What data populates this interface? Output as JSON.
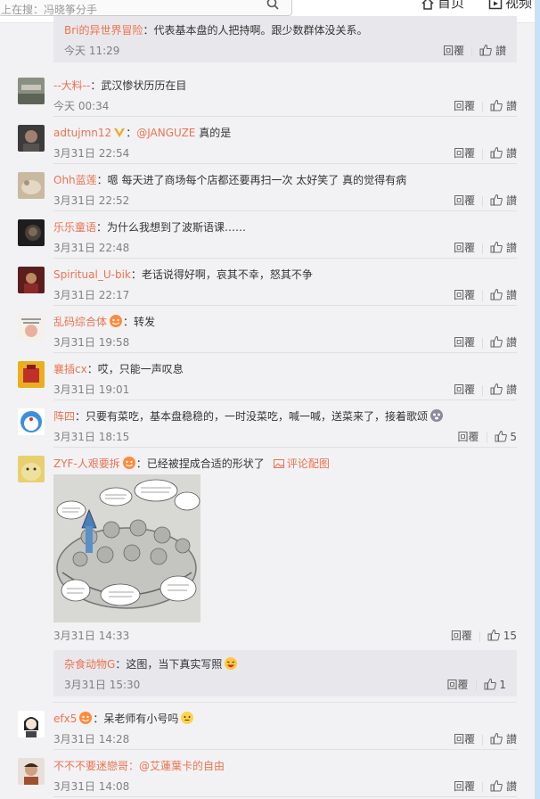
{
  "header": {
    "search_placeholder": "上在搜：冯晓筝分手",
    "home_label": "首页",
    "video_label": "视频"
  },
  "actions": {
    "reply_label": "回覆",
    "like_label": "讃"
  },
  "top_reply": {
    "user": "Bri的异世界冒险",
    "text": "：代表基本盘的人把持啊。跟少数群体没关系。",
    "time": "今天 11:29"
  },
  "comments": [
    {
      "user": "--大料--",
      "text": "：武汉惨状历历在目",
      "time": "今天 00:34"
    },
    {
      "user": "adtujmn12",
      "mention": "@JANGUZE",
      "text": " 真的是",
      "time": "3月31日 22:54"
    },
    {
      "user": "Ohh蓝莲",
      "text": "：嗯 每天进了商场每个店都还要再扫一次 太好笑了 真的觉得有病",
      "time": "3月31日 22:52"
    },
    {
      "user": "乐乐童语",
      "text": "：为什么我想到了波斯语课……",
      "time": "3月31日 22:48"
    },
    {
      "user": "Spiritual_U-bik",
      "text": "：老话说得好啊，哀其不幸，怒其不争",
      "time": "3月31日 22:17"
    },
    {
      "user": "乱码综合体",
      "text": "：转发",
      "time": "3月31日 19:58"
    },
    {
      "user": "襄插cx",
      "text": "：哎，只能一声叹息",
      "time": "3月31日 19:01"
    },
    {
      "user": "阵四",
      "text": "：只要有菜吃，基本盘稳稳的，一时没菜吃，喊一喊，送菜来了，接着歌颂",
      "time": "3月31日 18:15",
      "likes": "5"
    },
    {
      "user": "ZYF-人艰要拆",
      "text": "：已经被捏成合适的形状了",
      "pic_link": "评论配图",
      "time": "3月31日 14:33",
      "likes": "15"
    },
    {
      "user": "efx5",
      "text": "：呆老师有小号吗",
      "time": "3月31日 14:28"
    },
    {
      "user": "不不不要迷戀哥",
      "mention": "：@艾蓮葉卡的自由",
      "time": "3月31日 14:08"
    }
  ],
  "sub_reply": {
    "user": "杂食动物G",
    "text": "：这图，当下真实写照",
    "time": "3月31日 15:30",
    "likes": "1"
  },
  "colors": {
    "username": "#eb7350",
    "background": "#f2f2f5",
    "sub_reply_bg": "#e8e8ec"
  }
}
